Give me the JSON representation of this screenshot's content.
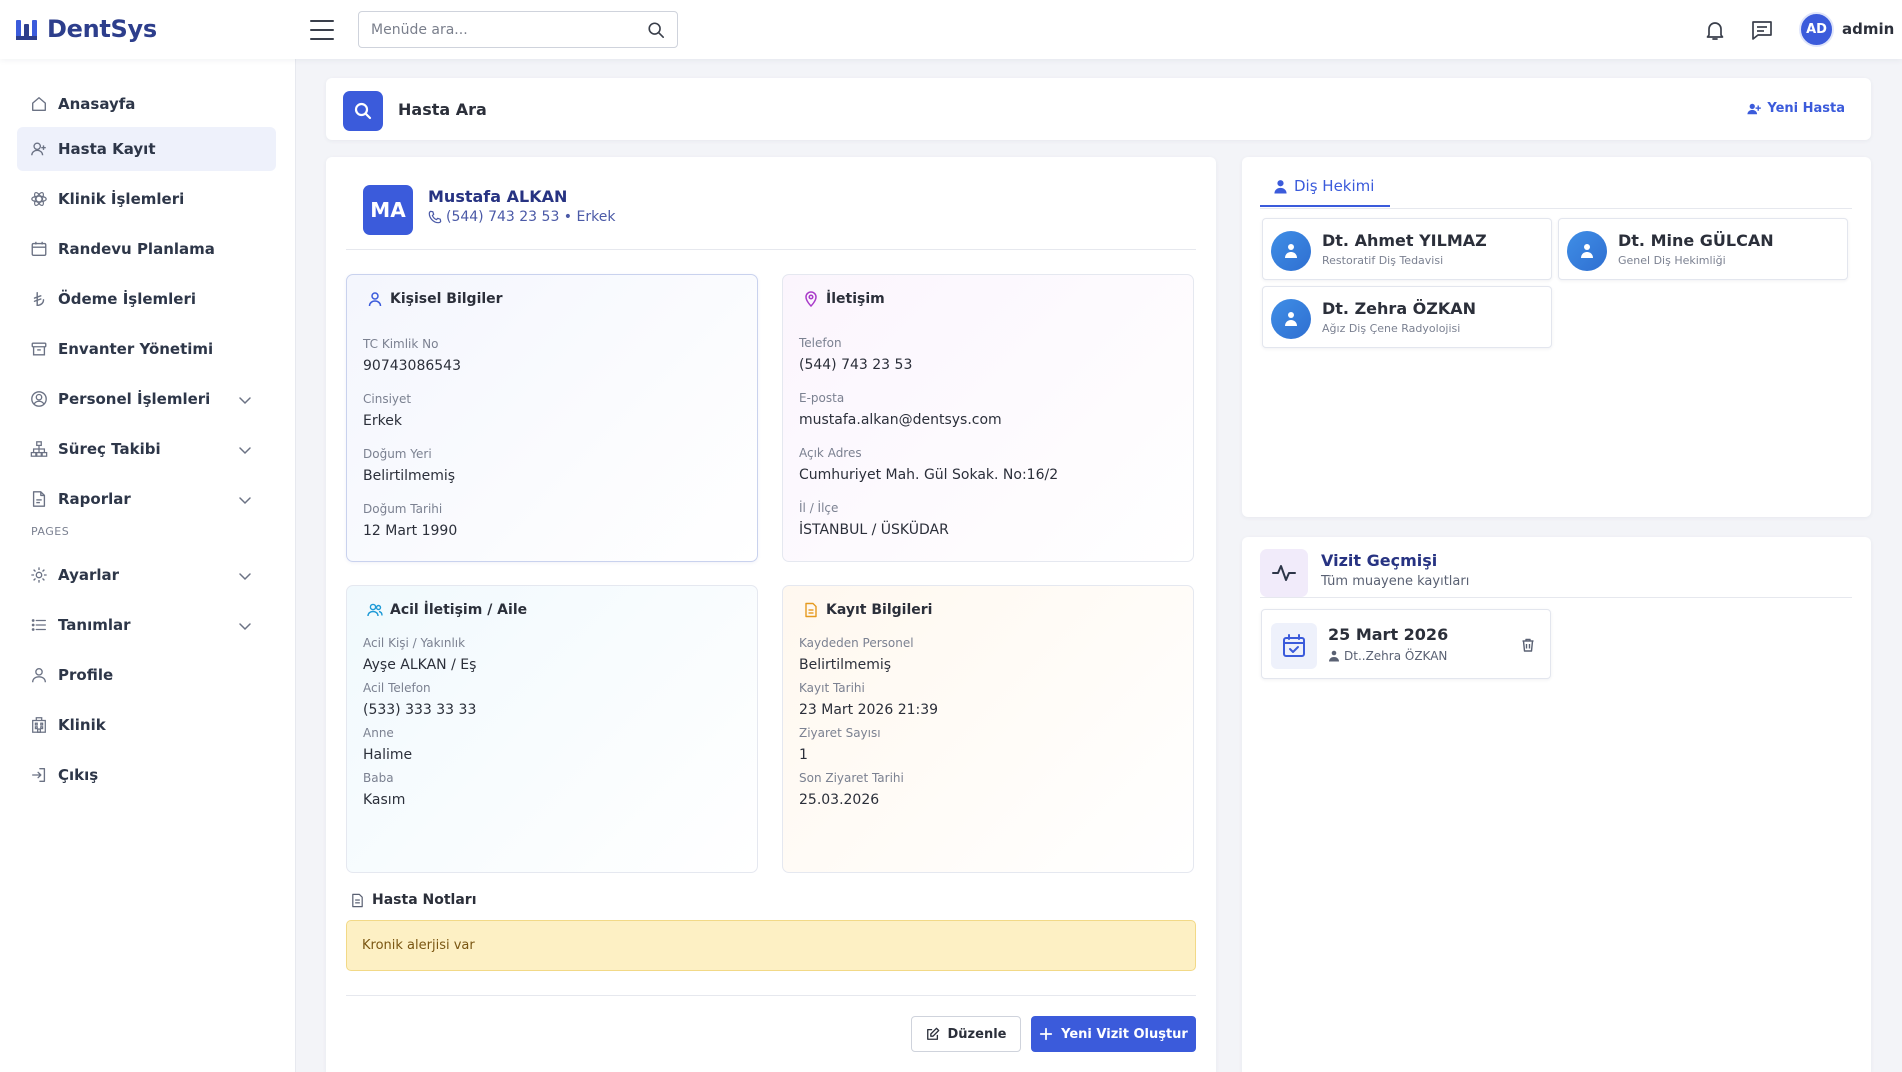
{
  "app": {
    "brand": "DentSys"
  },
  "header": {
    "search_placeholder": "Menüde ara...",
    "avatar_initials": "AD",
    "user_name": "admin"
  },
  "sidebar": {
    "items": [
      {
        "label": "Anasayfa"
      },
      {
        "label": "Hasta Kayıt"
      },
      {
        "label": "Klinik İşlemleri"
      },
      {
        "label": "Randevu Planlama"
      },
      {
        "label": "Ödeme İşlemleri"
      },
      {
        "label": "Envanter Yönetimi"
      },
      {
        "label": "Personel İşlemleri"
      },
      {
        "label": "Süreç Takibi"
      },
      {
        "label": "Raporlar"
      },
      {
        "label": "Ayarlar"
      },
      {
        "label": "Tanımlar"
      },
      {
        "label": "Profile"
      },
      {
        "label": "Klinik"
      },
      {
        "label": "Çıkış"
      }
    ],
    "section_pages": "PAGES"
  },
  "page": {
    "title": "Hasta Ara",
    "new_patient_label": "Yeni Hasta"
  },
  "patient": {
    "initials": "MA",
    "name": "Mustafa ALKAN",
    "summary": "(544) 743 23 53 • Erkek",
    "personal": {
      "title": "Kişisel Bilgiler",
      "fields": [
        {
          "label": "TC Kimlik No",
          "value": "90743086543"
        },
        {
          "label": "Cinsiyet",
          "value": "Erkek"
        },
        {
          "label": "Doğum Yeri",
          "value": "Belirtilmemiş"
        },
        {
          "label": "Doğum Tarihi",
          "value": "12 Mart 1990"
        }
      ]
    },
    "contact": {
      "title": "İletişim",
      "fields": [
        {
          "label": "Telefon",
          "value": "(544) 743 23 53"
        },
        {
          "label": "E-posta",
          "value": "mustafa.alkan@dentsys.com"
        },
        {
          "label": "Açık Adres",
          "value": "Cumhuriyet Mah. Gül Sokak. No:16/2"
        },
        {
          "label": "İl / İlçe",
          "value": "İSTANBUL / ÜSKÜDAR"
        }
      ]
    },
    "emergency": {
      "title": "Acil İletişim / Aile",
      "fields": [
        {
          "label": "Acil Kişi / Yakınlık",
          "value": "Ayşe ALKAN / Eş"
        },
        {
          "label": "Acil Telefon",
          "value": "(533) 333 33 33"
        },
        {
          "label": "Anne",
          "value": "Halime"
        },
        {
          "label": "Baba",
          "value": "Kasım"
        }
      ]
    },
    "registration": {
      "title": "Kayıt Bilgileri",
      "fields": [
        {
          "label": "Kaydeden Personel",
          "value": "Belirtilmemiş"
        },
        {
          "label": "Kayıt Tarihi",
          "value": "23 Mart 2026 21:39"
        },
        {
          "label": "Ziyaret Sayısı",
          "value": "1"
        },
        {
          "label": "Son Ziyaret Tarihi",
          "value": "25.03.2026"
        }
      ]
    },
    "notes_title": "Hasta Notları",
    "notes": "Kronik alerjisi var",
    "edit_label": "Düzenle",
    "new_visit_label": "Yeni Vizit Oluştur"
  },
  "dentists": {
    "tab_label": "Diş Hekimi",
    "items": [
      {
        "name": "Dt. Ahmet YILMAZ",
        "specialty": "Restoratif Diş Tedavisi"
      },
      {
        "name": "Dt. Mine GÜLCAN",
        "specialty": "Genel Diş Hekimliği"
      },
      {
        "name": "Dt. Zehra ÖZKAN",
        "specialty": "Ağız Diş Çene Radyolojisi"
      }
    ]
  },
  "visits": {
    "title": "Vizit Geçmişi",
    "subtitle": "Tüm muayene kayıtları",
    "items": [
      {
        "date": "25 Mart 2026",
        "doctor": "Dt..Zehra ÖZKAN"
      }
    ]
  },
  "colors": {
    "accent": "#3b5bdb",
    "brand": "#2d3e8c",
    "note_bg": "#fdf0c4"
  }
}
